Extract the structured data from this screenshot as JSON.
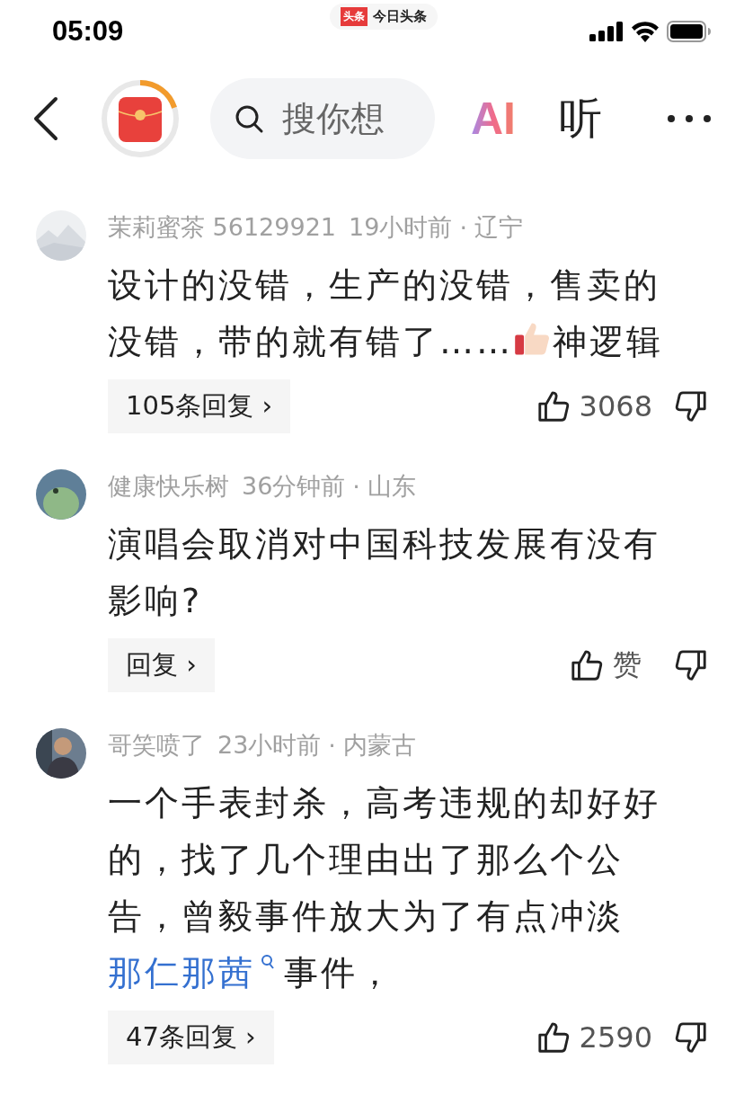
{
  "status_bar": {
    "time": "05:09",
    "app_badge": "头条",
    "app_name": "今日头条"
  },
  "nav": {
    "level": 0.2,
    "search_placeholder": "搜你想",
    "ai_label": "AI",
    "listen_label": "听"
  },
  "comments": [
    {
      "author": "茉莉蜜茶 56129921",
      "time": "19小时前",
      "separator": "·",
      "location": "辽宁",
      "body": [
        {
          "kind": "text",
          "text": "设计的没错，生产的没错，售卖的没错，带的就有错了……"
        },
        {
          "kind": "emoji"
        },
        {
          "kind": "text",
          "text": "神逻辑"
        }
      ],
      "reply_label": "105条回复",
      "reply_chevron": "›",
      "like_label": "3068"
    },
    {
      "author": "健康快乐树",
      "time": "36分钟前",
      "separator": "·",
      "location": "山东",
      "body": [
        {
          "kind": "text",
          "text": "演唱会取消对中国科技发展有没有影响?"
        }
      ],
      "reply_label": "回复",
      "reply_chevron": "›",
      "like_label": "赞"
    },
    {
      "author": "哥笑喷了",
      "time": "23小时前",
      "separator": "·",
      "location": "内蒙古",
      "body": [
        {
          "kind": "text",
          "text": "一个手表封杀，高考违规的却好好的，找了几个理由出了那么个公告，曾毅事件放大为了有点冲淡"
        },
        {
          "kind": "link",
          "text": "那仁那茜"
        },
        {
          "kind": "text",
          "text": "事件，"
        }
      ],
      "reply_label": "47条回复",
      "reply_chevron": "›",
      "like_label": "2590"
    }
  ]
}
